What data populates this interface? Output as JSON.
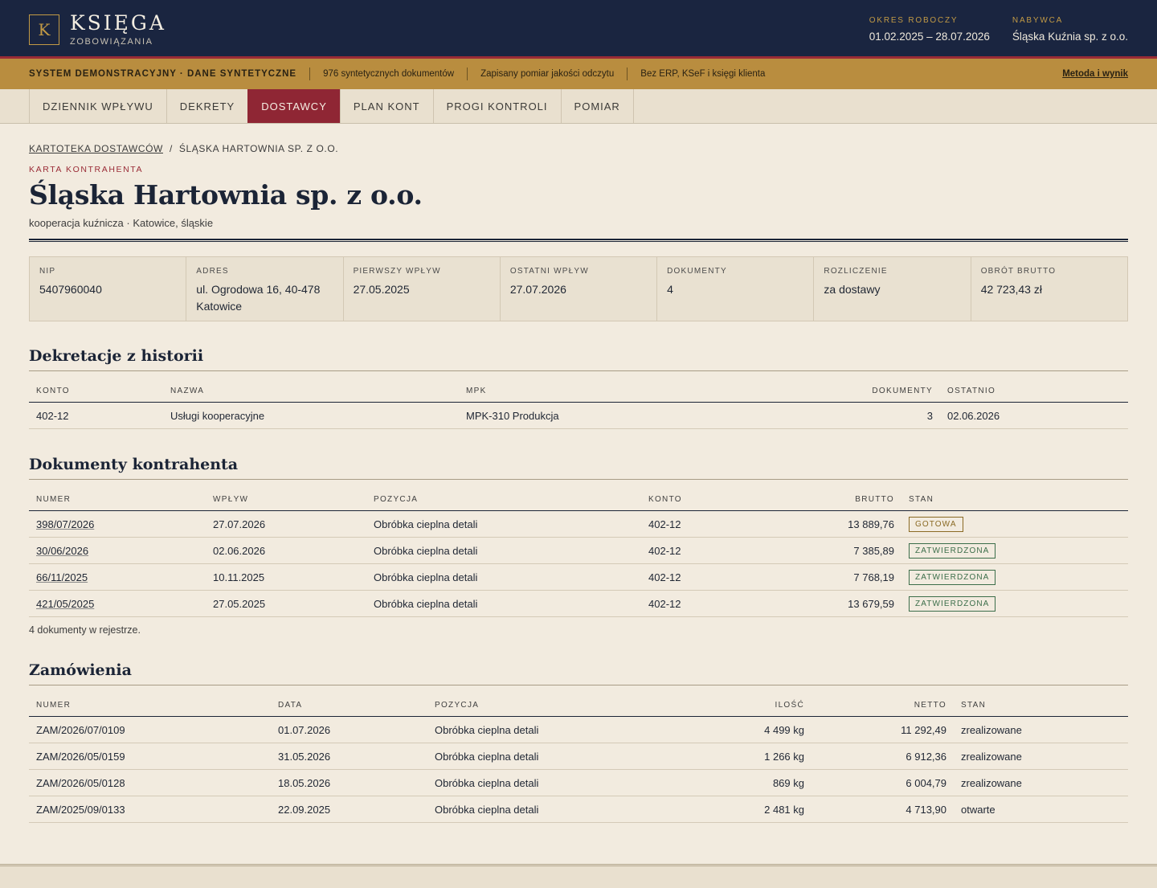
{
  "header": {
    "logo_letter": "K",
    "title": "KSIĘGA",
    "subtitle": "ZOBOWIĄZANIA",
    "period_label": "OKRES ROBOCZY",
    "period_value": "01.02.2025 – 28.07.2026",
    "buyer_label": "NABYWCA",
    "buyer_value": "Śląska Kuźnia sp. z o.o."
  },
  "notice": {
    "main": "SYSTEM DEMONSTRACYJNY · DANE SYNTETYCZNE",
    "item1": "976 syntetycznych dokumentów",
    "item2": "Zapisany pomiar jakości odczytu",
    "item3": "Bez ERP, KSeF i księgi klienta",
    "link": "Metoda i wynik"
  },
  "tabs": [
    "DZIENNIK WPŁYWU",
    "DEKRETY",
    "DOSTAWCY",
    "PLAN KONT",
    "PROGI KONTROLI",
    "POMIAR"
  ],
  "breadcrumb": {
    "parent": "KARTOTEKA DOSTAWCÓW",
    "separator": "/",
    "current": "ŚLĄSKA HARTOWNIA SP. Z O.O."
  },
  "card": {
    "eyebrow": "KARTA KONTRAHENTA",
    "title": "Śląska Hartownia sp. z o.o.",
    "subtitle": "kooperacja kuźnicza · Katowice, śląskie"
  },
  "facts": [
    {
      "label": "NIP",
      "value": "5407960040"
    },
    {
      "label": "ADRES",
      "value": "ul. Ogrodowa 16, 40-478 Katowice"
    },
    {
      "label": "PIERWSZY WPŁYW",
      "value": "27.05.2025"
    },
    {
      "label": "OSTATNI WPŁYW",
      "value": "27.07.2026"
    },
    {
      "label": "DOKUMENTY",
      "value": "4"
    },
    {
      "label": "ROZLICZENIE",
      "value": "za dostawy"
    },
    {
      "label": "OBRÓT BRUTTO",
      "value": "42 723,43 zł"
    }
  ],
  "history": {
    "title": "Dekretacje z historii",
    "headers": [
      "KONTO",
      "NAZWA",
      "MPK",
      "DOKUMENTY",
      "OSTATNIO"
    ],
    "rows": [
      [
        "402-12",
        "Usługi kooperacyjne",
        "MPK-310 Produkcja",
        "3",
        "02.06.2026"
      ]
    ]
  },
  "documents": {
    "title": "Dokumenty kontrahenta",
    "headers": [
      "NUMER",
      "WPŁYW",
      "POZYCJA",
      "KONTO",
      "BRUTTO",
      "STAN"
    ],
    "rows": [
      [
        "398/07/2026",
        "27.07.2026",
        "Obróbka cieplna detali",
        "402-12",
        "13 889,76",
        "GOTOWA"
      ],
      [
        "30/06/2026",
        "02.06.2026",
        "Obróbka cieplna detali",
        "402-12",
        "7 385,89",
        "ZATWIERDZONA"
      ],
      [
        "66/11/2025",
        "10.11.2025",
        "Obróbka cieplna detali",
        "402-12",
        "7 768,19",
        "ZATWIERDZONA"
      ],
      [
        "421/05/2025",
        "27.05.2025",
        "Obróbka cieplna detali",
        "402-12",
        "13 679,59",
        "ZATWIERDZONA"
      ]
    ],
    "note": "4 dokumenty w rejestrze."
  },
  "orders": {
    "title": "Zamówienia",
    "headers": [
      "NUMER",
      "DATA",
      "POZYCJA",
      "ILOŚĆ",
      "NETTO",
      "STAN"
    ],
    "rows": [
      [
        "ZAM/2026/07/0109",
        "01.07.2026",
        "Obróbka cieplna detali",
        "4 499 kg",
        "11 292,49",
        "zrealizowane"
      ],
      [
        "ZAM/2026/05/0159",
        "31.05.2026",
        "Obróbka cieplna detali",
        "1 266 kg",
        "6 912,36",
        "zrealizowane"
      ],
      [
        "ZAM/2026/05/0128",
        "18.05.2026",
        "Obróbka cieplna detali",
        "869 kg",
        "6 004,79",
        "zrealizowane"
      ],
      [
        "ZAM/2025/09/0133",
        "22.09.2025",
        "Obróbka cieplna detali",
        "2 481 kg",
        "4 713,90",
        "otwarte"
      ]
    ]
  },
  "colors": {
    "navy": "#1a2540",
    "gold": "#b98d3f",
    "crimson": "#8f2634",
    "paper": "#f2ebdf"
  }
}
